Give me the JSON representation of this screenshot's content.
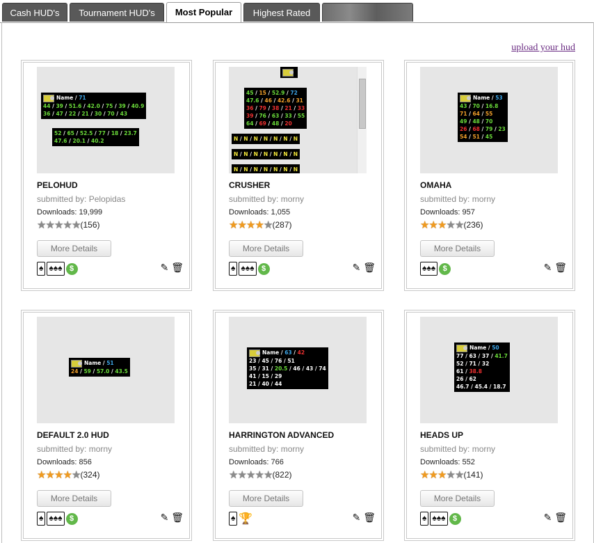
{
  "tabs": [
    {
      "label": "Cash HUD's"
    },
    {
      "label": "Tournament HUD's"
    },
    {
      "label": "Most Popular"
    },
    {
      "label": "Highest Rated"
    },
    {
      "label": ""
    }
  ],
  "upload_link": "upload your hud",
  "more_details_label": "More Details",
  "icons": {
    "spade_card": "single-card-icon",
    "three_cards": "multi-card-icon",
    "cash": "dollar-icon",
    "tournament": "trophy-icon",
    "edit": "edit-icon",
    "delete": "trash-icon"
  },
  "colors": {
    "star_on": "#f09a1e",
    "star_off": "#8b8b8b",
    "dollar": "#62b84a",
    "link": "#6b2d83"
  },
  "cards": [
    {
      "title": "PELOHUD",
      "submitted": "submitted by: Pelopidas",
      "downloads": "Downloads: 19,999",
      "rating": 0,
      "count": "(156)"
    },
    {
      "title": "CRUSHER",
      "submitted": "submitted by: morny",
      "downloads": "Downloads: 1,055",
      "rating": 4,
      "count": "(287)"
    },
    {
      "title": "OMAHA",
      "submitted": "submitted by: morny",
      "downloads": "Downloads: 957",
      "rating": 3,
      "count": "(236)"
    },
    {
      "title": "DEFAULT 2.0 HUD",
      "submitted": "submitted by: morny",
      "downloads": "Downloads: 856",
      "rating": 4,
      "count": "(324)"
    },
    {
      "title": "HARRINGTON ADVANCED",
      "submitted": "submitted by: morny",
      "downloads": "Downloads: 766",
      "rating": 0,
      "count": "(822)"
    },
    {
      "title": "HEADS UP",
      "submitted": "submitted by: morny",
      "downloads": "Downloads: 552",
      "rating": 3,
      "count": "(141)"
    }
  ],
  "huds": {
    "name": "Name",
    "pelo": {
      "n": "71",
      "r1": [
        "44",
        "39",
        "51.6",
        "42.0",
        "75",
        "39",
        "40.9"
      ],
      "r2": [
        "36",
        "47",
        "22",
        "21",
        "30",
        "70",
        "43"
      ],
      "r3": [
        "52",
        "65",
        "52.5",
        "77",
        "18",
        "23.7"
      ],
      "r4": [
        "47.6",
        "20.1",
        "40.2"
      ]
    },
    "crusher": {
      "r1": [
        "45",
        "15",
        "52.9",
        "72"
      ],
      "r2": [
        "47.6",
        "46",
        "42.6",
        "31"
      ],
      "r3": [
        "36",
        "79",
        "38",
        "21",
        "33"
      ],
      "r4": [
        "39",
        "76",
        "63",
        "33",
        "55"
      ],
      "r5": [
        "64",
        "69",
        "48",
        "20"
      ],
      "n": "N"
    },
    "omaha": {
      "n": "53",
      "r1": [
        "43",
        "70",
        "16.8"
      ],
      "r2": [
        "71",
        "64",
        "55"
      ],
      "r3": [
        "49",
        "48",
        "70"
      ],
      "r4": [
        "26",
        "68",
        "79",
        "23"
      ],
      "r5": [
        "54",
        "51",
        "45"
      ]
    },
    "default": {
      "n": "51",
      "r1": [
        "24",
        "59",
        "57.0",
        "43.5"
      ]
    },
    "harrington": {
      "n1": "63",
      "n2": "42",
      "r1": [
        "23",
        "45",
        "76",
        "51"
      ],
      "r2": [
        "35",
        "31",
        "20.5",
        "46",
        "43",
        "74"
      ],
      "r3": [
        "41",
        "15",
        "29"
      ],
      "r4": [
        "21",
        "40",
        "44"
      ]
    },
    "headsup": {
      "n": "50",
      "r1": [
        "77",
        "63",
        "37",
        "41.7"
      ],
      "r2": [
        "52",
        "71",
        "32"
      ],
      "r3": [
        "61",
        "38.8"
      ],
      "r4": [
        "26",
        "62"
      ],
      "r5": [
        "46.7",
        "45.4",
        "18.7"
      ]
    }
  }
}
